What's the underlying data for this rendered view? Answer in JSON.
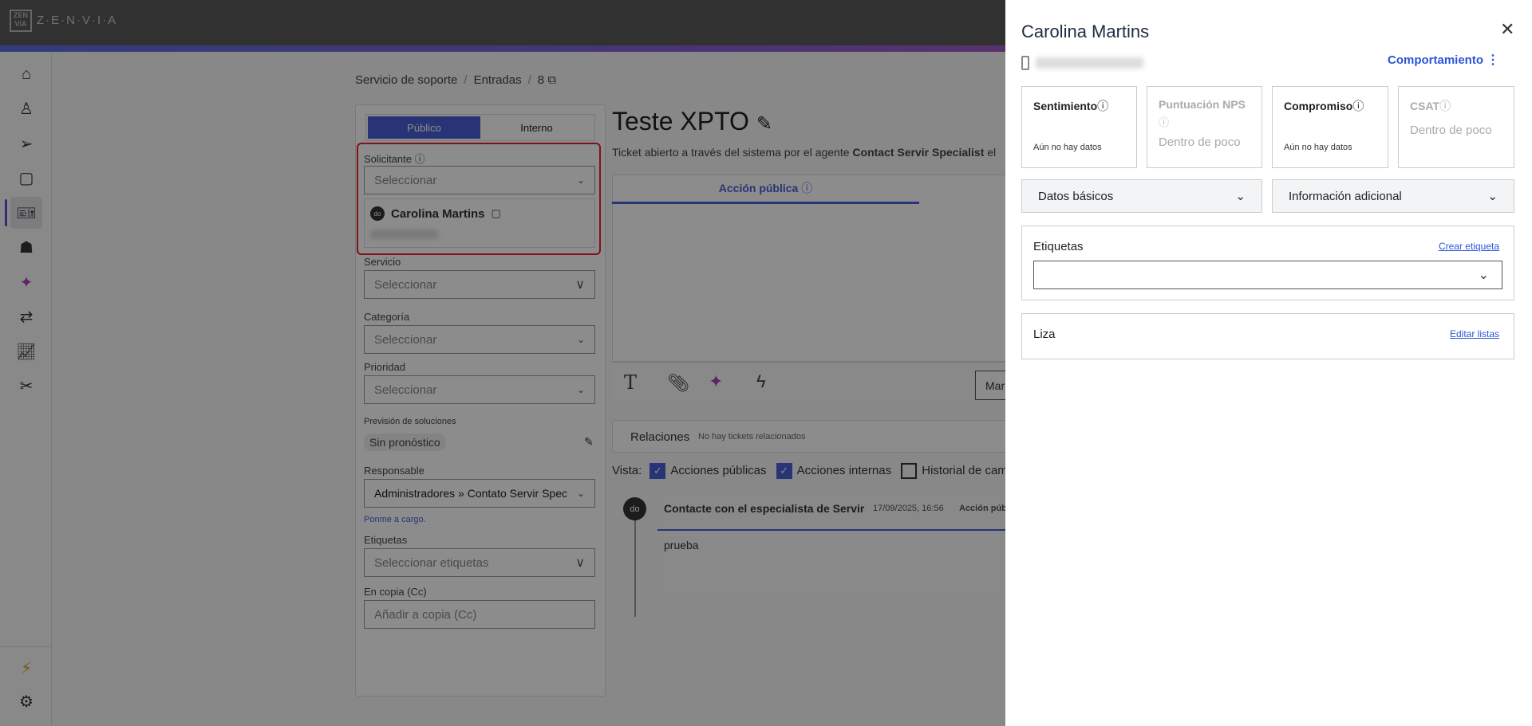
{
  "app": {
    "brand": "Z·E·N·V·I·A",
    "logo_text": "ZEN VIA"
  },
  "sidebar": {
    "icons": [
      "home-icon",
      "contacts-icon",
      "send-icon",
      "chat-icon",
      "ticket-icon",
      "bot-icon",
      "sparkle-icon",
      "flow-icon",
      "chart-icon",
      "tools-icon"
    ],
    "bottom_icons": [
      "lightning-icon",
      "gear-icon"
    ]
  },
  "breadcrumb": {
    "items": [
      "Servicio de soporte",
      "Entradas",
      "8"
    ]
  },
  "form": {
    "tabs": [
      "Público",
      "Interno"
    ],
    "solicitante_label": "Solicitante",
    "solicitante_placeholder": "Seleccionar",
    "contact_initials": "do",
    "contact_name": "Carolina Martins",
    "servicio_label": "Servicio",
    "servicio_value": "Seleccionar",
    "categoria_label": "Categoría",
    "categoria_value": "Seleccionar",
    "prioridad_label": "Prioridad",
    "prioridad_value": "Seleccionar",
    "prevision_label": "Previsión de soluciones",
    "prevision_value": "Sin pronóstico",
    "responsable_label": "Responsable",
    "responsable_value": "Administradores » Contato Servir Spec",
    "ponme_link": "Ponme a cargo.",
    "etiquetas_label": "Etiquetas",
    "etiquetas_placeholder": "Seleccionar etiquetas",
    "cc_label": "En copia (Cc)",
    "cc_placeholder": "Añadir a copia (Cc)"
  },
  "ticket": {
    "title": "Teste XPTO",
    "desc_prefix": "Ticket abierto a través del sistema por el agente ",
    "desc_agent": "Contact Servir Specialist",
    "desc_suffix": " el",
    "editor_tab": "Acción pública",
    "toolbar_button": "Mar",
    "relations_label": "Relaciones",
    "relations_empty": "No hay tickets relacionados",
    "vista_label": "Vista:",
    "filters": [
      {
        "label": "Acciones públicas",
        "checked": true
      },
      {
        "label": "Acciones internas",
        "checked": true
      },
      {
        "label": "Historial de cambi",
        "checked": false
      }
    ],
    "action": {
      "initials": "do",
      "author": "Contacte con el especialista de Servir",
      "date": "17/09/2025, 16:56",
      "type": "Acción públ",
      "body": "prueba"
    }
  },
  "contact_panel": {
    "name": "Carolina Martins",
    "behavior_link": "Comportamiento",
    "metrics": [
      {
        "title": "Sentimiento",
        "value": "Aún no hay datos",
        "enabled": true
      },
      {
        "title": "Puntuación NPS",
        "value": "Dentro de poco",
        "enabled": false
      },
      {
        "title": "Compromiso",
        "value": "Aún no hay datos",
        "enabled": true
      },
      {
        "title": "CSAT",
        "value": "Dentro de poco",
        "enabled": false
      }
    ],
    "accordions": [
      "Datos básicos",
      "Información adicional"
    ],
    "tags_label": "Etiquetas",
    "create_tag": "Crear etiqueta",
    "lists_label": "Liza",
    "edit_lists": "Editar listas"
  },
  "colors": {
    "accent": "#4a5fd6",
    "highlight": "#e8202a",
    "link": "#2b55d9"
  }
}
